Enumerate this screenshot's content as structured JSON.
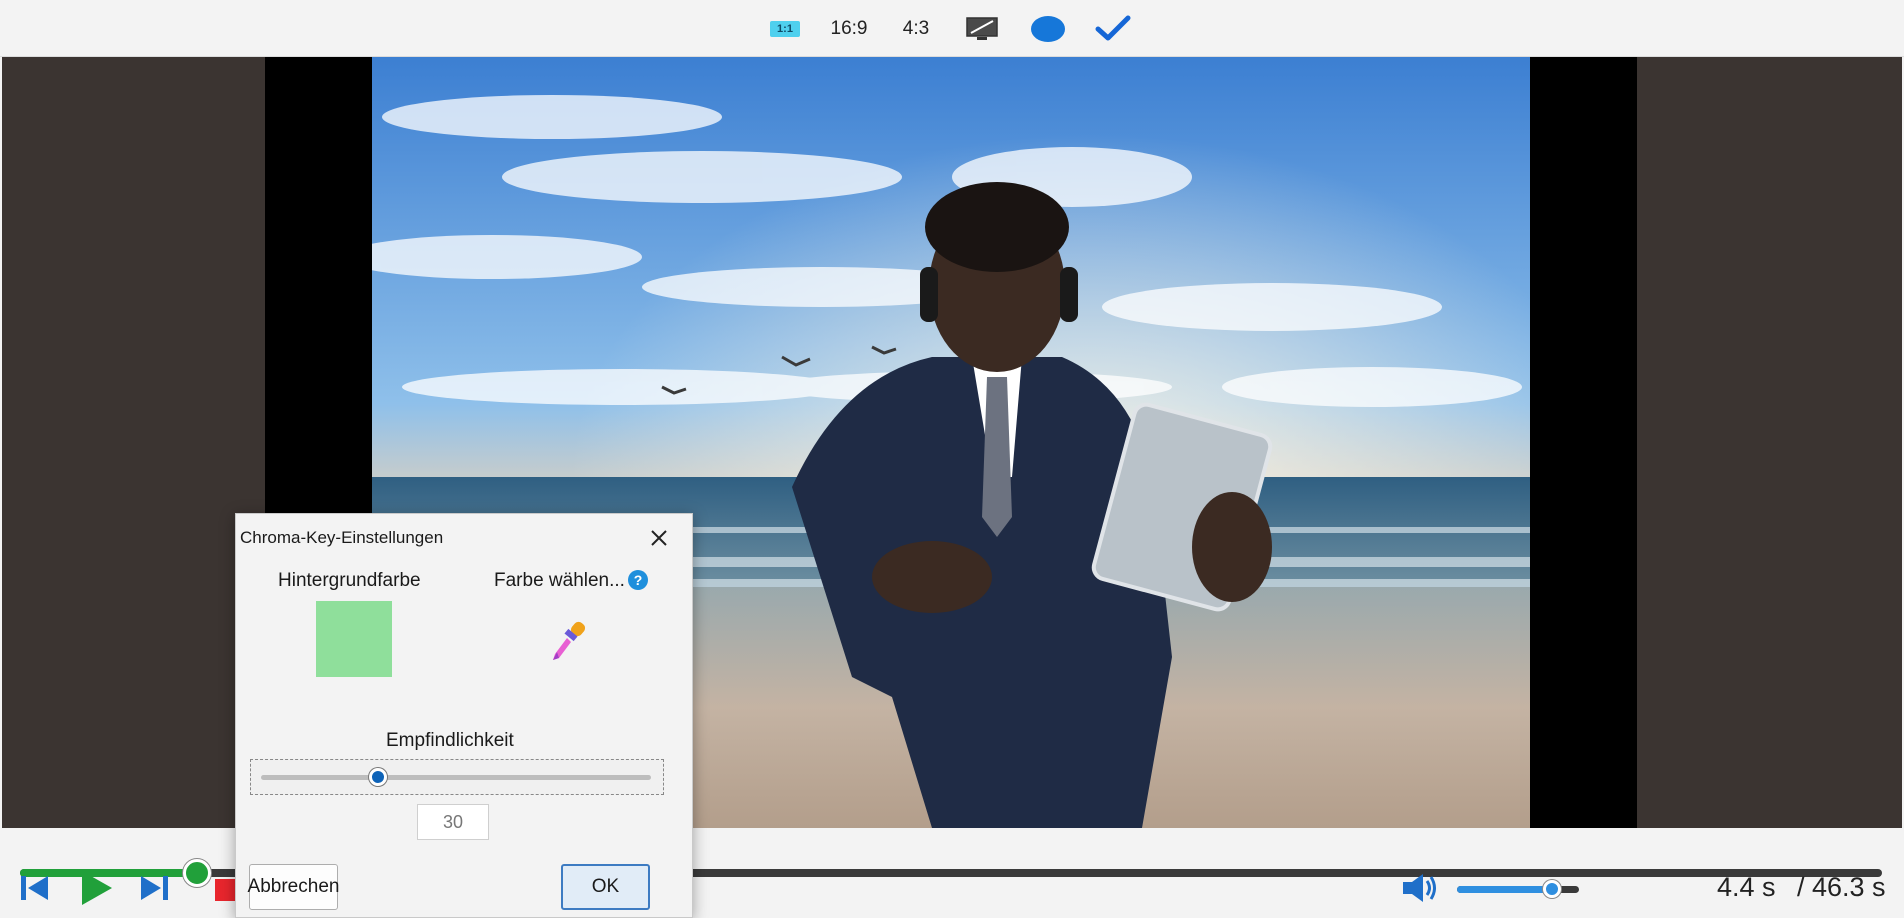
{
  "toolbar": {
    "ratio_1_1": "1:1",
    "ratio_16_9": "16:9",
    "ratio_4_3": "4:3",
    "icons": [
      "monitor-icon",
      "circle-icon",
      "checkmark-icon"
    ]
  },
  "player": {
    "seek_progress": 0.095,
    "current_time": "4.4 s",
    "total_time": "/ 46.3 s",
    "volume_level": 0.78
  },
  "dialog": {
    "title": "Chroma-Key-Einstellungen",
    "background_color_label": "Hintergrundfarbe",
    "background_color": "#8fdf9b",
    "pick_color_label": "Farbe wählen...",
    "help_glyph": "?",
    "sensitivity_label": "Empfindlichkeit",
    "sensitivity_value": "30",
    "sensitivity_fraction": 0.3,
    "cancel_label": "Abbrechen",
    "ok_label": "OK"
  },
  "colors": {
    "accent_green": "#21a03a",
    "accent_blue": "#2f8fe0",
    "stop_red": "#e8262d"
  }
}
